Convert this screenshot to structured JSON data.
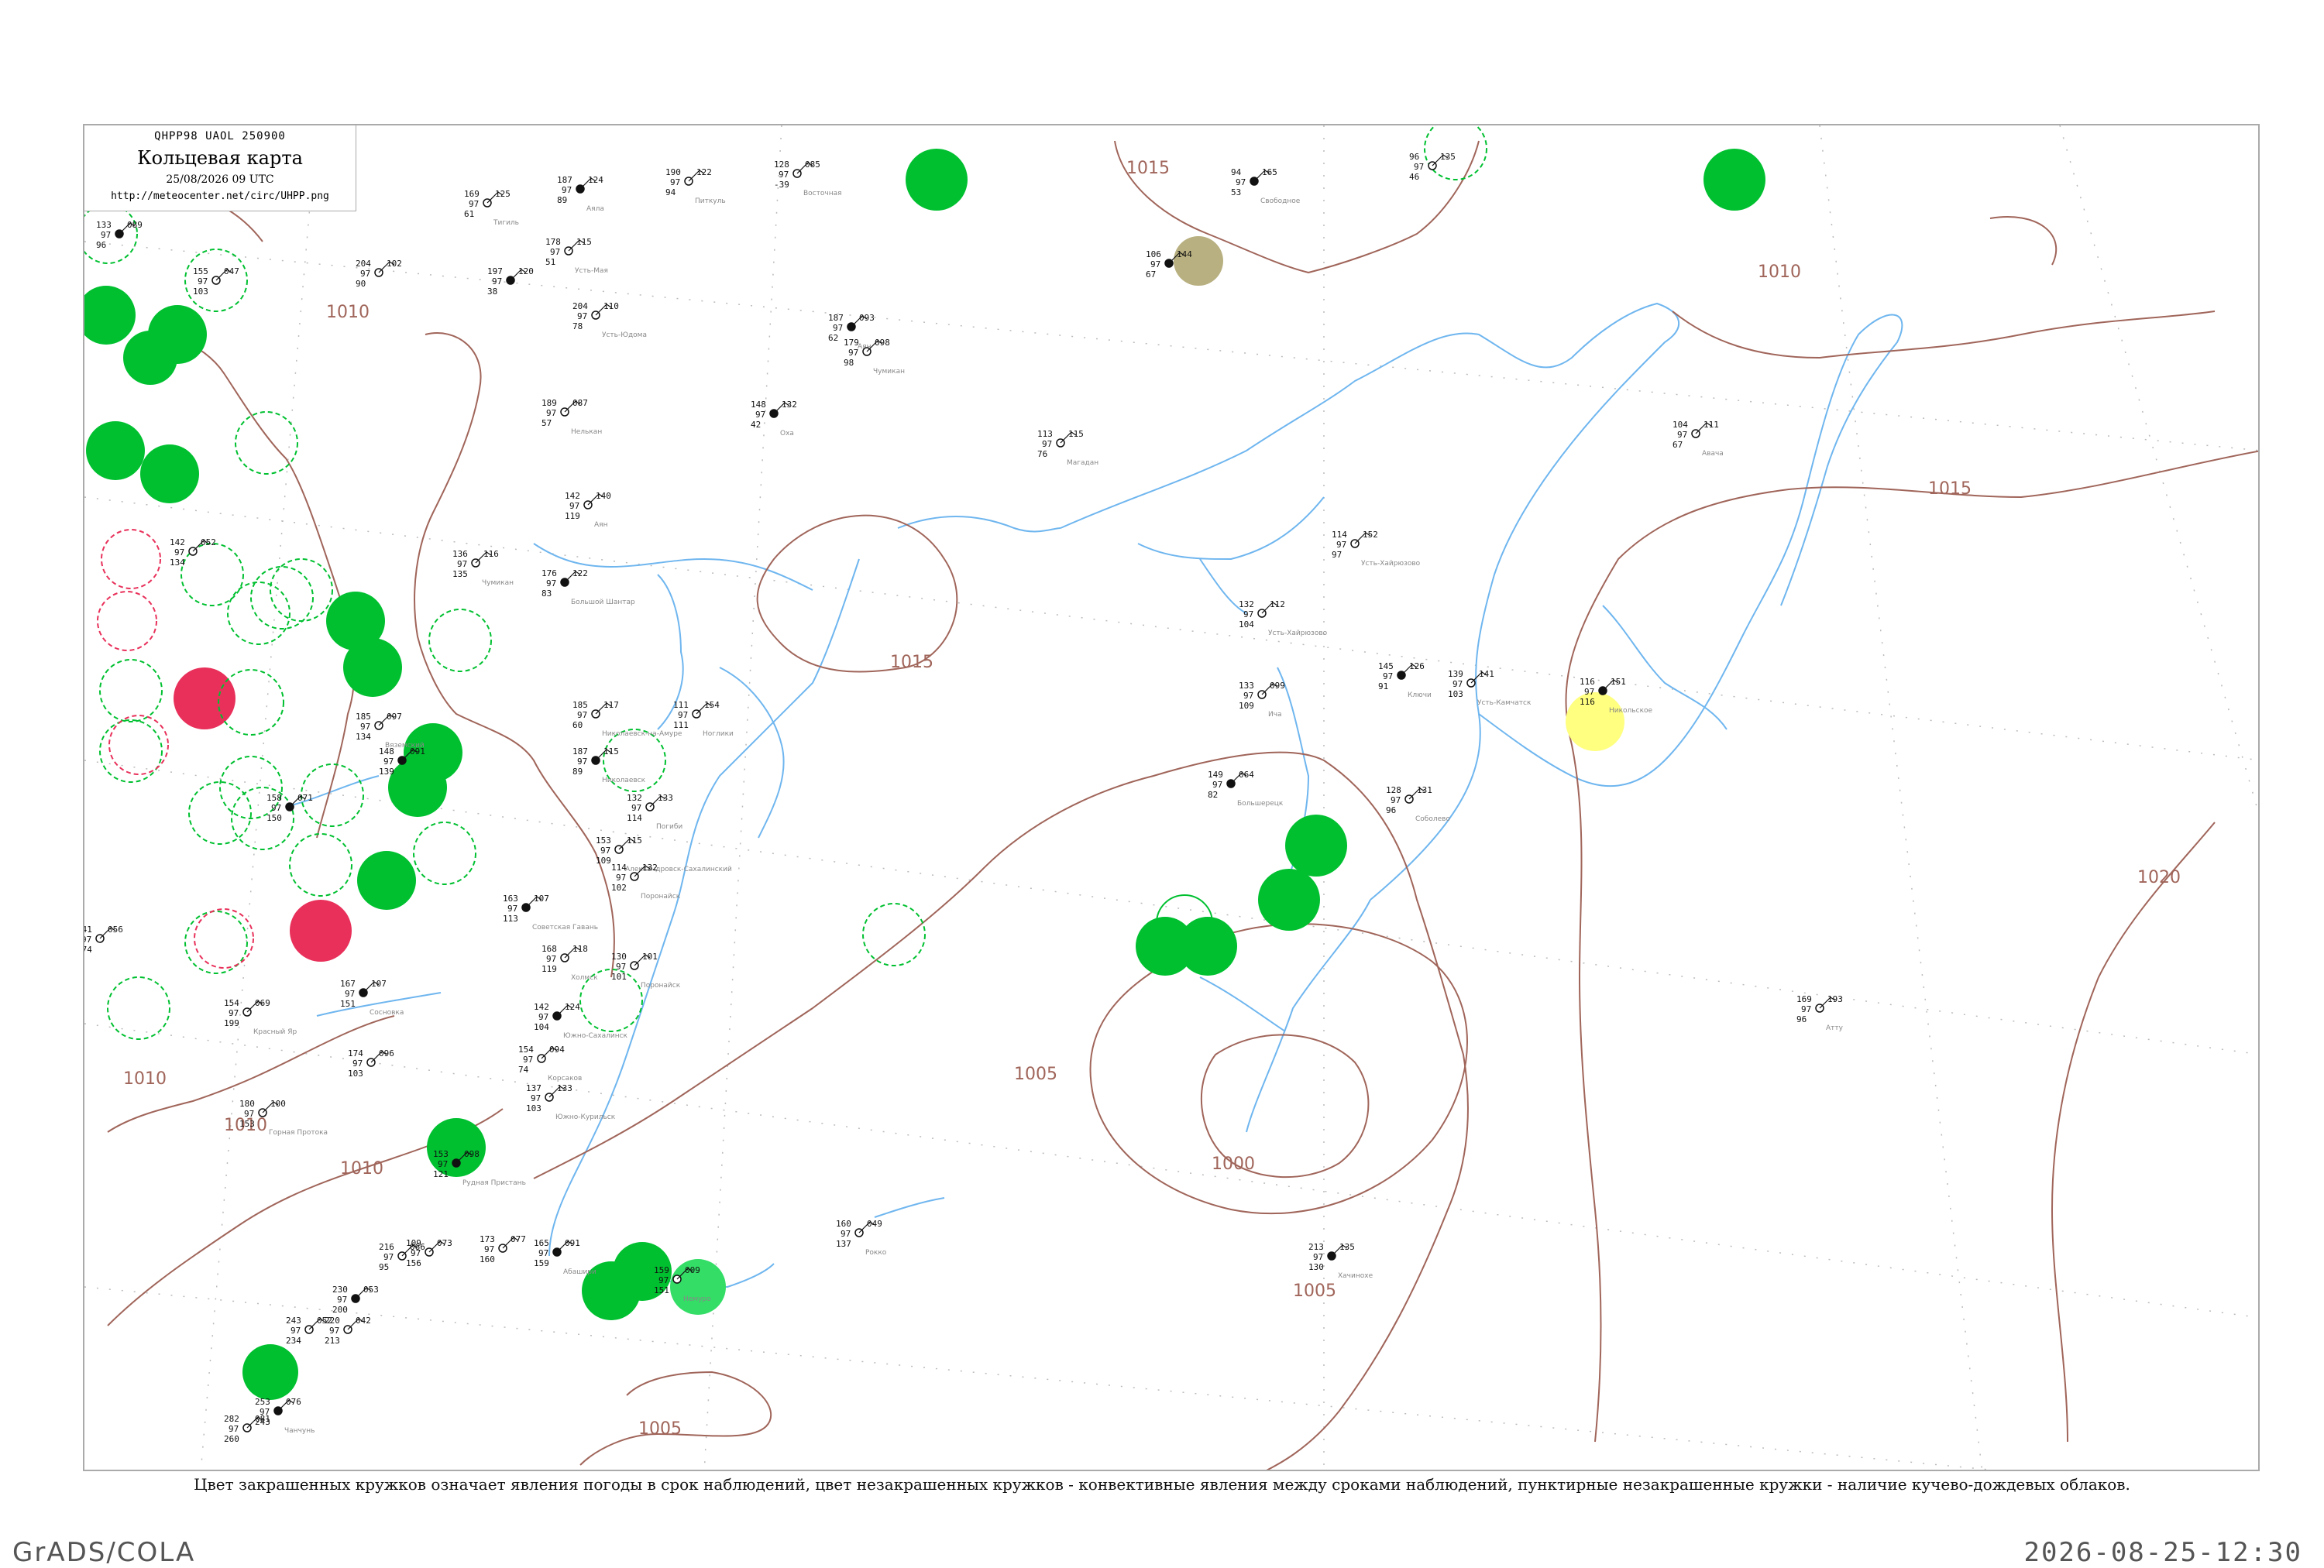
{
  "header": {
    "code": "QHPP98  UAOL  250900",
    "title": "Кольцевая карта",
    "date": "25/08/2026 09 UTC",
    "url": "http://meteocenter.net/circ/UHPP.png"
  },
  "caption": "Цвет закрашенных кружков означает явления погоды в срок наблюдений, цвет незакрашенных кружков - конвективные явления между сроками наблюдений, пунктирные незакрашенные кружки - наличие кучево-дождевых облаков.",
  "footer": {
    "left": "GrADS/COLA",
    "right": "2026-08-25-12:30"
  },
  "colors": {
    "isobar": "#a0655a",
    "coast": "#6fb6ef",
    "rain": "#00c030",
    "thunder": "#e8305a",
    "fog": "#b8b080",
    "haze": "#ffff80",
    "dashed_cb": "#00c030"
  },
  "isobars": [
    "1015",
    "1015",
    "1010",
    "1010",
    "1015",
    "1005",
    "1010",
    "1010",
    "1000",
    "1005",
    "1005",
    "1020",
    "1010"
  ],
  "stations": [
    {
      "p": "089",
      "t": "133",
      "d": "96",
      "name": ""
    },
    {
      "p": "047",
      "t": "155",
      "d": "103",
      "name": ""
    },
    {
      "p": "125",
      "t": "169",
      "d": "61",
      "name": "Тигиль"
    },
    {
      "p": "124",
      "t": "187",
      "d": "89",
      "name": "Аяла"
    },
    {
      "p": "122",
      "t": "190",
      "d": "94",
      "name": "Питкуль"
    },
    {
      "p": "085",
      "t": "128",
      "d": "-39",
      "name": "Восточная"
    },
    {
      "p": "165",
      "t": "94",
      "d": "53",
      "name": "Свободное"
    },
    {
      "p": "135",
      "t": "96",
      "d": "46",
      "name": ""
    },
    {
      "p": "102",
      "t": "204",
      "d": "90",
      "name": ""
    },
    {
      "p": "120",
      "t": "197",
      "d": "38",
      "name": ""
    },
    {
      "p": "115",
      "t": "178",
      "d": "51",
      "name": "Усть-Мая"
    },
    {
      "p": "110",
      "t": "204",
      "d": "78",
      "name": "Усть-Юдома"
    },
    {
      "p": "093",
      "t": "187",
      "d": "62",
      "name": "Аян"
    },
    {
      "p": "098",
      "t": "179",
      "d": "98",
      "name": "Чумикан"
    },
    {
      "p": "087",
      "t": "189",
      "d": "57",
      "name": "Нелькан"
    },
    {
      "p": "132",
      "t": "148",
      "d": "42",
      "name": "Оха"
    },
    {
      "p": "115",
      "t": "113",
      "d": "76",
      "name": "Магадан"
    },
    {
      "p": "111",
      "t": "104",
      "d": "67",
      "name": "Авача"
    },
    {
      "p": "144",
      "t": "106",
      "d": "67",
      "name": ""
    },
    {
      "p": "140",
      "t": "142",
      "d": "119",
      "name": "Аян"
    },
    {
      "p": "116",
      "t": "136",
      "d": "135",
      "name": "Чумикан"
    },
    {
      "p": "122",
      "t": "176",
      "d": "83",
      "name": "Большой Шантар"
    },
    {
      "p": "152",
      "t": "114",
      "d": "97",
      "name": "Усть-Хайрюзово"
    },
    {
      "p": "112",
      "t": "132",
      "d": "104",
      "name": "Усть-Хайрюзово"
    },
    {
      "p": "126",
      "t": "145",
      "d": "91",
      "name": "Ключи"
    },
    {
      "p": "141",
      "t": "139",
      "d": "103",
      "name": "Усть-Камчатск"
    },
    {
      "p": "099",
      "t": "133",
      "d": "109",
      "name": "Ича"
    },
    {
      "p": "151",
      "t": "116",
      "d": "116",
      "name": "Никольское"
    },
    {
      "p": "117",
      "t": "185",
      "d": "60",
      "name": "Николаевск-на-Амуре"
    },
    {
      "p": "154",
      "t": "111",
      "d": "111",
      "name": "Ноглики"
    },
    {
      "p": "115",
      "t": "187",
      "d": "89",
      "name": "Николаевск"
    },
    {
      "p": "131",
      "t": "128",
      "d": "96",
      "name": "Соболево"
    },
    {
      "p": "133",
      "t": "132",
      "d": "114",
      "name": "Погиби"
    },
    {
      "p": "064",
      "t": "149",
      "d": "82",
      "name": "Большерецк"
    },
    {
      "p": "115",
      "t": "153",
      "d": "109",
      "name": "Александровск-Сахалинский"
    },
    {
      "p": "132",
      "t": "114",
      "d": "102",
      "name": "Поронайск"
    },
    {
      "p": "107",
      "t": "163",
      "d": "113",
      "name": "Советская Гавань"
    },
    {
      "p": "118",
      "t": "168",
      "d": "119",
      "name": "Холмск"
    },
    {
      "p": "101",
      "t": "130",
      "d": "101",
      "name": "Поронайск"
    },
    {
      "p": "124",
      "t": "142",
      "d": "104",
      "name": "Южно-Сахалинск"
    },
    {
      "p": "094",
      "t": "154",
      "d": "74",
      "name": "Корсаков"
    },
    {
      "p": "133",
      "t": "137",
      "d": "103",
      "name": "Южно-Курильск"
    },
    {
      "p": "107",
      "t": "167",
      "d": "151",
      "name": "Сосновка"
    },
    {
      "p": "096",
      "t": "174",
      "d": "103",
      "name": ""
    },
    {
      "p": "100",
      "t": "180",
      "d": "153",
      "name": "Горная Протока"
    },
    {
      "p": "098",
      "t": "153",
      "d": "121",
      "name": "Рудная Пристань"
    },
    {
      "p": "073",
      "t": "109",
      "d": "156",
      "name": ""
    },
    {
      "p": "077",
      "t": "173",
      "d": "160",
      "name": ""
    },
    {
      "p": "091",
      "t": "165",
      "d": "159",
      "name": "Абашири"
    },
    {
      "p": "009",
      "t": "159",
      "d": "151",
      "name": "Немуро"
    },
    {
      "p": "049",
      "t": "160",
      "d": "137",
      "name": "Рокко"
    },
    {
      "p": "135",
      "t": "213",
      "d": "130",
      "name": "Хачинохе"
    },
    {
      "p": "193",
      "t": "169",
      "d": "96",
      "name": "Атту"
    },
    {
      "p": "056",
      "t": "241",
      "d": "174",
      "name": ""
    },
    {
      "p": "071",
      "t": "158",
      "d": "150",
      "name": ""
    },
    {
      "p": "069",
      "t": "154",
      "d": "199",
      "name": "Красный Яр"
    },
    {
      "p": "097",
      "t": "185",
      "d": "134",
      "name": "Вяземский"
    },
    {
      "p": "091",
      "t": "148",
      "d": "139",
      "name": ""
    },
    {
      "p": "052",
      "t": "142",
      "d": "134",
      "name": ""
    },
    {
      "p": "066",
      "t": "216",
      "d": "95",
      "name": ""
    },
    {
      "p": "053",
      "t": "230",
      "d": "200",
      "name": ""
    },
    {
      "p": "042",
      "t": "220",
      "d": "213",
      "name": ""
    },
    {
      "p": "052",
      "t": "243",
      "d": "234",
      "name": ""
    },
    {
      "p": "076",
      "t": "253",
      "d": "243",
      "name": "Чанчунь"
    },
    {
      "p": "081",
      "t": "282",
      "d": "260",
      "name": ""
    }
  ]
}
